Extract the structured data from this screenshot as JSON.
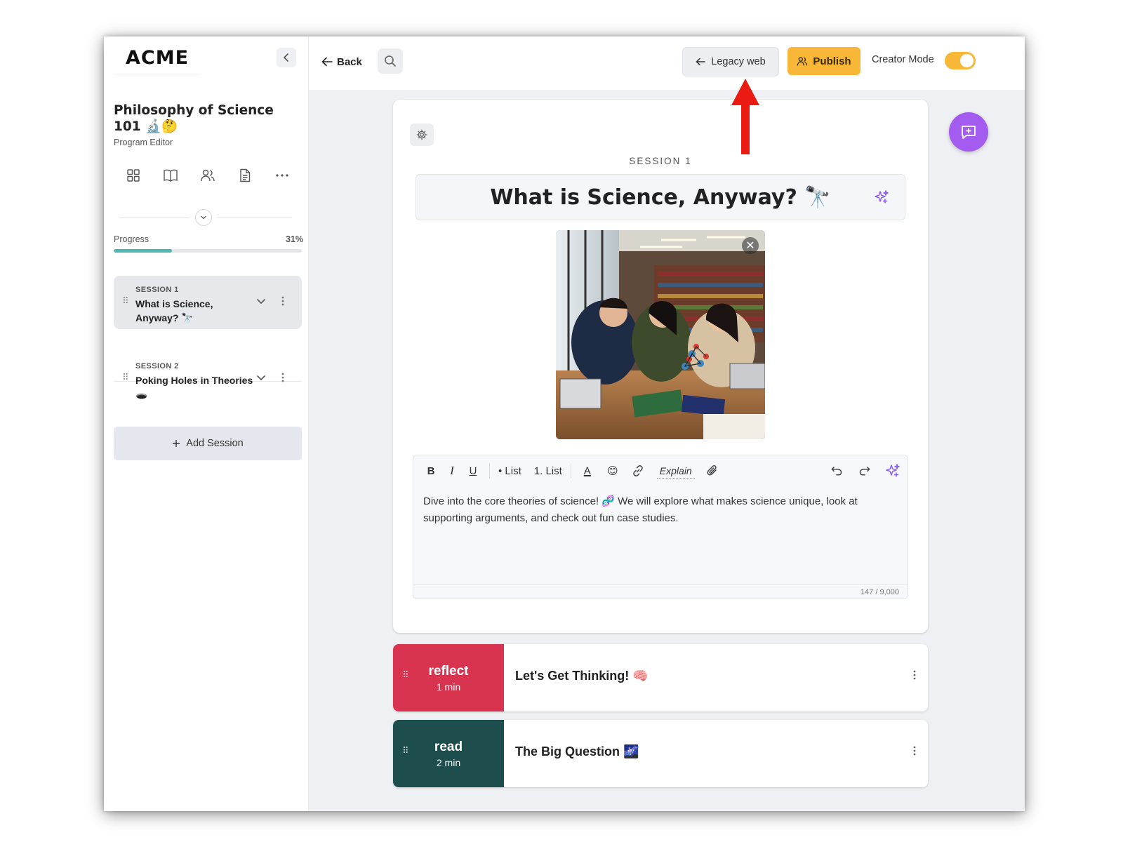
{
  "sidebar": {
    "logo": "ACME",
    "program_title": "Philosophy of Science 101 🔬🤔",
    "program_subtitle": "Program Editor",
    "progress": {
      "label": "Progress",
      "value_text": "31%",
      "fraction": 0.31
    },
    "sessions": [
      {
        "label": "SESSION 1",
        "title": "What is Science, Anyway? 🔭",
        "active": true
      },
      {
        "label": "SESSION 2",
        "title": "Poking Holes in Theories 🕳️",
        "active": false
      }
    ],
    "add_session_label": "Add Session",
    "icons": [
      "grid-icon",
      "book-icon",
      "users-icon",
      "document-icon",
      "more-horizontal-icon"
    ]
  },
  "topbar": {
    "back_label": "Back",
    "legacy_label": "Legacy web",
    "publish_label": "Publish",
    "creator_mode_label": "Creator Mode",
    "creator_mode_on": true
  },
  "editor": {
    "session_label": "SESSION 1",
    "title": "What is Science, Anyway? 🔭",
    "toolbar": {
      "bold": "B",
      "italic": "I",
      "underline": "U",
      "bullet_list": "• List",
      "numbered_list": "1. List",
      "text_color": "A",
      "emoji": "😊",
      "explain": "Explain"
    },
    "body": "Dive into the core theories of science! 🧬 We will explore what makes science unique, look at supporting arguments, and check out fun case studies.",
    "char_count": "147 / 9,000"
  },
  "activities": [
    {
      "type": "reflect",
      "duration": "1 min",
      "title": "Let's Get Thinking! 🧠",
      "color": "#d9344f"
    },
    {
      "type": "read",
      "duration": "2 min",
      "title": "The Big Question 🌌",
      "color": "#1e4d4e"
    }
  ],
  "colors": {
    "accent": "#f8b737",
    "progress": "#4fb8b2",
    "ai_sparkle": "#8b5cf6",
    "chat_fab": "#a35bf0",
    "annotation_arrow": "#ea1b12"
  }
}
